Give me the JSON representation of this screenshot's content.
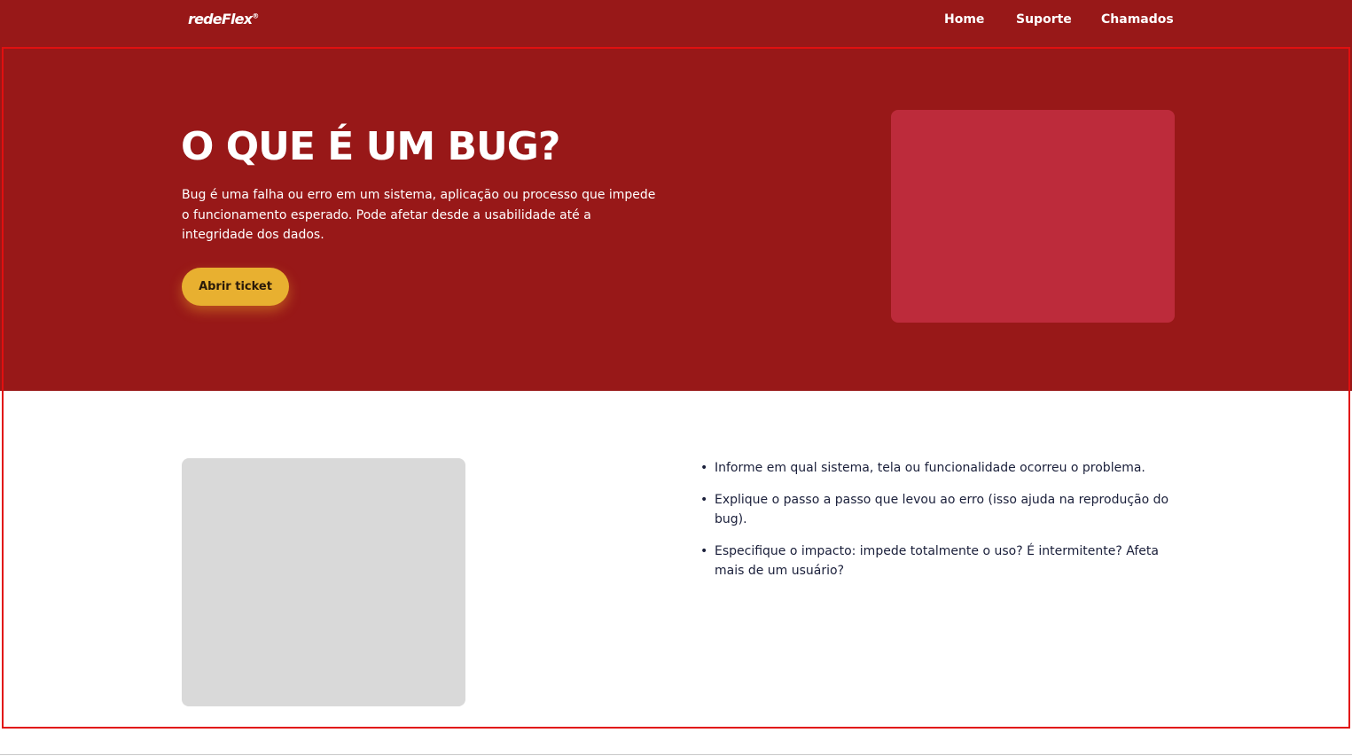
{
  "brand": {
    "logo_text": "redeFlex",
    "logo_mark": "®"
  },
  "nav": {
    "items": [
      {
        "label": "Home"
      },
      {
        "label": "Suporte"
      },
      {
        "label": "Chamados"
      }
    ]
  },
  "hero": {
    "title": "O QUE É UM BUG?",
    "description": "Bug é uma falha ou erro em um sistema, aplicação ou processo que impede o funcionamento esperado. Pode afetar desde a usabilidade até a integridade dos dados.",
    "cta_label": "Abrir ticket"
  },
  "tips": {
    "items": [
      {
        "text": "Informe em qual sistema, tela ou funcionalidade ocorreu o problema."
      },
      {
        "text": "Explique o passo a passo que levou ao erro (isso ajuda na reprodução do bug)."
      },
      {
        "text": "Especifique o impacto: impede totalmente o uso? É intermitente? Afeta mais de um usuário?"
      }
    ],
    "bullet": "•"
  },
  "colors": {
    "primary": "#981818",
    "hero_image_placeholder": "#bd2b3b",
    "cta": "#e8b030",
    "image_placeholder": "#d9d9d9",
    "text_dark": "#1a1f3a",
    "highlight_frame": "#e11010"
  }
}
